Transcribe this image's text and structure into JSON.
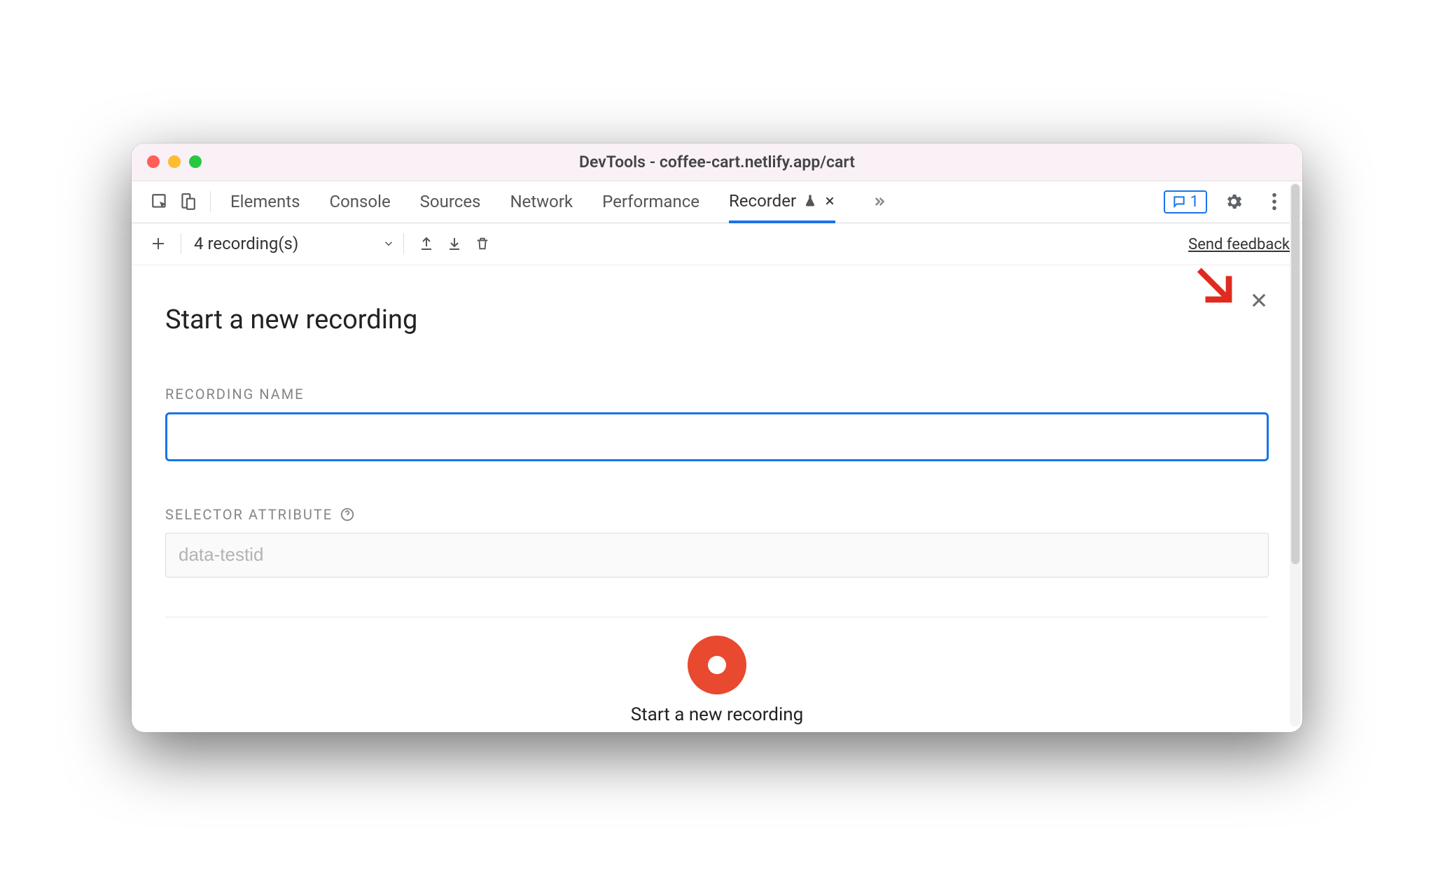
{
  "window": {
    "title": "DevTools - coffee-cart.netlify.app/cart"
  },
  "tabs": {
    "items": [
      "Elements",
      "Console",
      "Sources",
      "Network",
      "Performance",
      "Recorder"
    ],
    "active_index": 5,
    "badge_count": "1"
  },
  "toolbar": {
    "recordings_label": "4 recording(s)",
    "feedback_label": "Send feedback"
  },
  "panel": {
    "heading": "Start a new recording",
    "recording_name_label": "Recording Name",
    "recording_name_value": "",
    "selector_label": "Selector Attribute",
    "selector_placeholder": "data-testid",
    "selector_value": ""
  },
  "footer": {
    "start_label": "Start a new recording"
  }
}
